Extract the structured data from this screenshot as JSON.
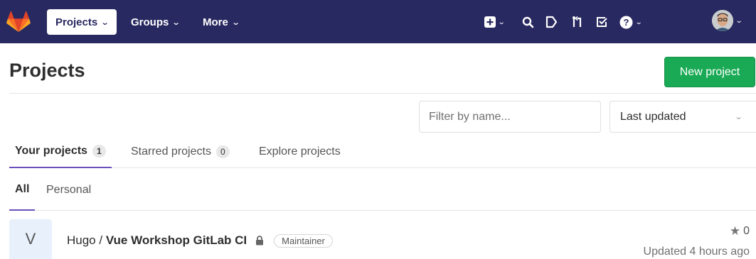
{
  "navbar": {
    "projects_label": "Projects",
    "groups_label": "Groups",
    "more_label": "More",
    "chevron": "⌄",
    "icons": [
      "plus-square-icon",
      "search-icon",
      "issues-icon",
      "merge-request-icon",
      "todo-icon",
      "help-icon",
      "user-avatar"
    ],
    "background": "#292961"
  },
  "header": {
    "title": "Projects",
    "new_project_label": "New project",
    "accent": "#1aaa55"
  },
  "filters": {
    "filter_placeholder": "Filter by name...",
    "sort_value": "Last updated"
  },
  "tabs": [
    {
      "label": "Your projects",
      "count": "1"
    },
    {
      "label": "Starred projects",
      "count": "0"
    },
    {
      "label": "Explore projects"
    }
  ],
  "subtabs": [
    "All",
    "Personal"
  ],
  "project": {
    "avatar_letter": "V",
    "namespace": "Hugo / ",
    "name": "Vue Workshop GitLab CI",
    "role": "Maintainer",
    "stars": "0",
    "updated": "Updated 4 hours ago"
  }
}
